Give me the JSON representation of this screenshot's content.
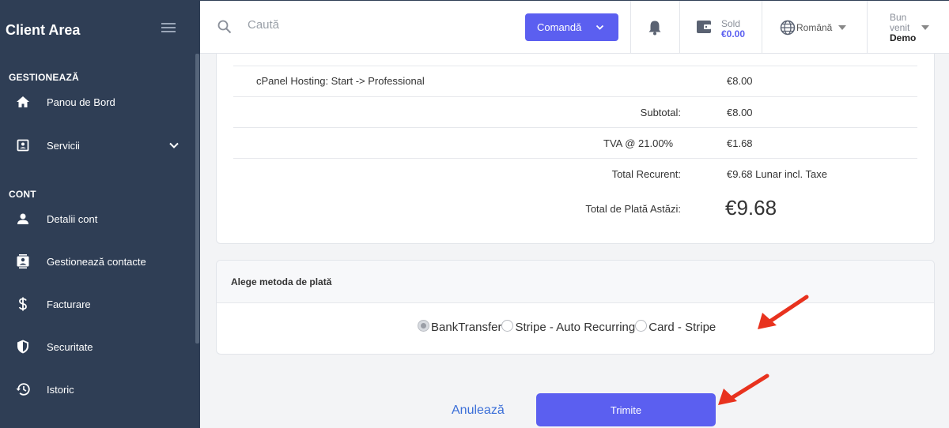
{
  "sidebar": {
    "brand": "Client Area",
    "sections": [
      {
        "title": "GESTIONEAZĂ"
      },
      {
        "title": "CONT"
      }
    ],
    "items": [
      {
        "label": "Panou de Bord",
        "icon": "home-icon"
      },
      {
        "label": "Servicii",
        "icon": "services-icon"
      },
      {
        "label": "Detalii cont",
        "icon": "person-icon"
      },
      {
        "label": "Gestionează contacte",
        "icon": "contacts-icon"
      },
      {
        "label": "Facturare",
        "icon": "dollar-icon"
      },
      {
        "label": "Securitate",
        "icon": "shield-icon"
      },
      {
        "label": "Istoric",
        "icon": "history-icon"
      }
    ]
  },
  "header": {
    "search_placeholder": "Caută",
    "order_label": "Comandă",
    "sold_label": "Sold",
    "sold_value": "€0.00",
    "language": "Română",
    "welcome": "Bun venit",
    "user_name": "Demo"
  },
  "summary": {
    "product": "cPanel Hosting: Start -> Professional",
    "product_price": "€8.00",
    "subtotal_label": "Subtotal:",
    "subtotal_value": "€8.00",
    "tax_label": "TVA @ 21.00%",
    "tax_value": "€1.68",
    "recurring_label": "Total Recurent:",
    "recurring_value": "€9.68 Lunar incl. Taxe",
    "total_label": "Total de Plată Astăzi:",
    "total_value": "€9.68"
  },
  "payment": {
    "title": "Alege metoda de plată",
    "options": [
      {
        "label": "BankTransfer",
        "checked": true
      },
      {
        "label": "Stripe - Auto Recurring",
        "checked": false
      },
      {
        "label": "Card - Stripe",
        "checked": false
      }
    ]
  },
  "actions": {
    "cancel_label": "Anulează",
    "submit_label": "Trimite"
  },
  "colors": {
    "sidebar_bg": "#2f3e55",
    "accent": "#5b5ff0",
    "annotation_arrow": "#e8321e"
  }
}
